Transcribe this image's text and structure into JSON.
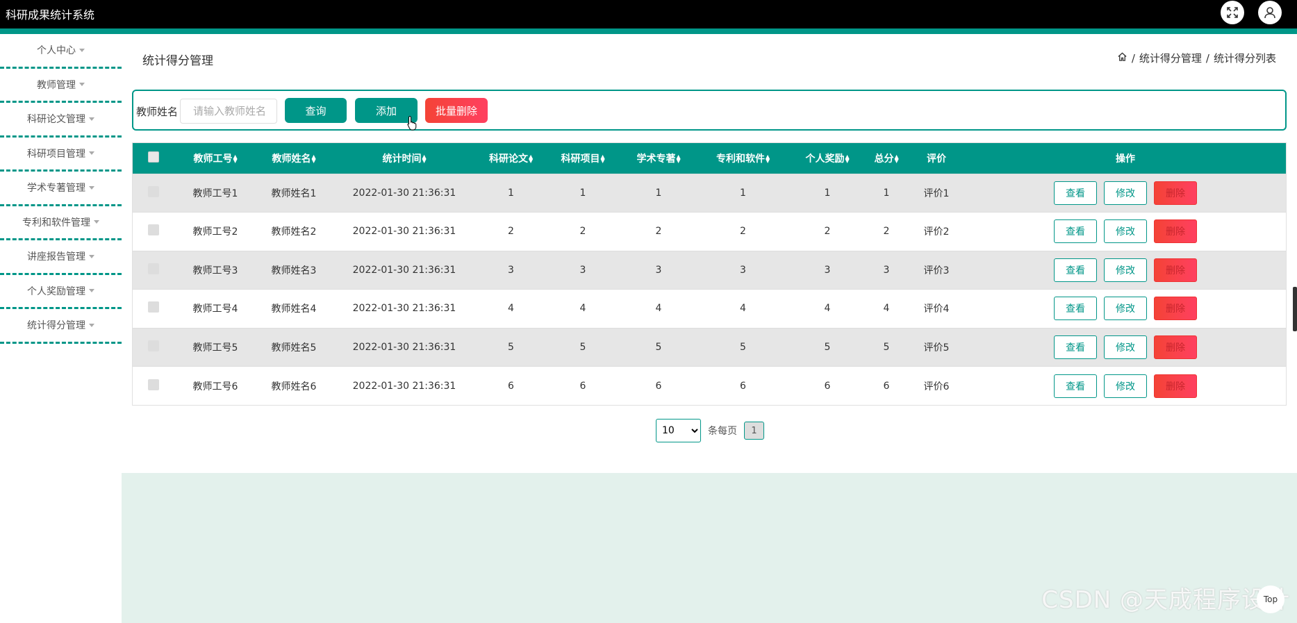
{
  "app": {
    "title": "科研成果统计系统"
  },
  "sidebar": {
    "items": [
      {
        "label": "个人中心"
      },
      {
        "label": "教师管理"
      },
      {
        "label": "科研论文管理"
      },
      {
        "label": "科研项目管理"
      },
      {
        "label": "学术专著管理"
      },
      {
        "label": "专利和软件管理"
      },
      {
        "label": "讲座报告管理"
      },
      {
        "label": "个人奖励管理"
      },
      {
        "label": "统计得分管理"
      }
    ]
  },
  "page": {
    "title": "统计得分管理",
    "breadcrumb": [
      "统计得分管理",
      "统计得分列表"
    ],
    "breadcrumb_sep": "/"
  },
  "search": {
    "label": "教师姓名",
    "placeholder": "请输入教师姓名",
    "query_label": "查询",
    "add_label": "添加",
    "batch_delete_label": "批量删除"
  },
  "table": {
    "headers": [
      "教师工号",
      "教师姓名",
      "统计时间",
      "科研论文",
      "科研项目",
      "学术专著",
      "专利和软件",
      "个人奖励",
      "总分",
      "评价",
      "操作"
    ],
    "rows": [
      [
        "教师工号1",
        "教师姓名1",
        "2022-01-30 21:36:31",
        "1",
        "1",
        "1",
        "1",
        "1",
        "1",
        "评价1"
      ],
      [
        "教师工号2",
        "教师姓名2",
        "2022-01-30 21:36:31",
        "2",
        "2",
        "2",
        "2",
        "2",
        "2",
        "评价2"
      ],
      [
        "教师工号3",
        "教师姓名3",
        "2022-01-30 21:36:31",
        "3",
        "3",
        "3",
        "3",
        "3",
        "3",
        "评价3"
      ],
      [
        "教师工号4",
        "教师姓名4",
        "2022-01-30 21:36:31",
        "4",
        "4",
        "4",
        "4",
        "4",
        "4",
        "评价4"
      ],
      [
        "教师工号5",
        "教师姓名5",
        "2022-01-30 21:36:31",
        "5",
        "5",
        "5",
        "5",
        "5",
        "5",
        "评价5"
      ],
      [
        "教师工号6",
        "教师姓名6",
        "2022-01-30 21:36:31",
        "6",
        "6",
        "6",
        "6",
        "6",
        "6",
        "评价6"
      ]
    ],
    "ops": {
      "view": "查看",
      "edit": "修改",
      "delete": "删除"
    }
  },
  "pager": {
    "page_size": "10",
    "per_page_label": "条每页",
    "current_page": "1"
  },
  "footer": {
    "watermark": "CSDN @天成程序设计",
    "top_label": "Top"
  },
  "colors": {
    "accent": "#009688",
    "danger": "#f44336",
    "topbar": "#000000"
  }
}
